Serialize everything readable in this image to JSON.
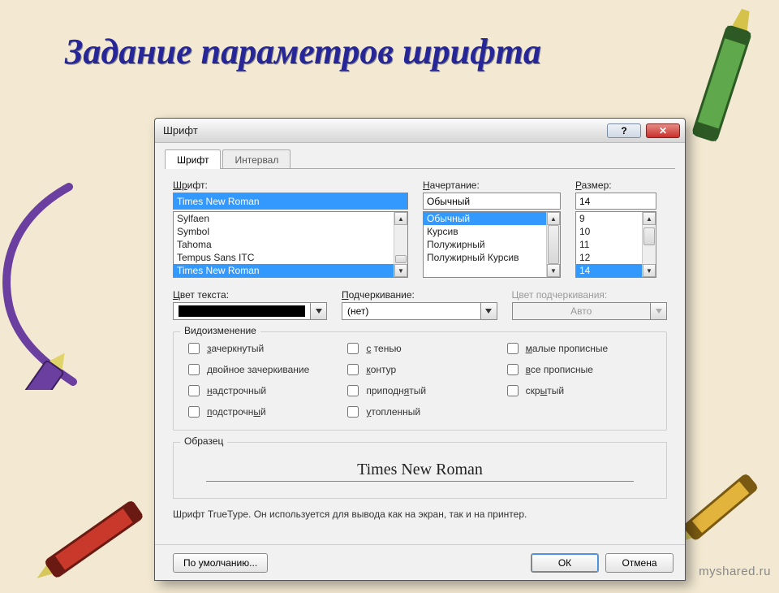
{
  "slide": {
    "title": "Задание параметров шрифта"
  },
  "watermark": "myshared.ru",
  "window": {
    "title": "Шрифт"
  },
  "tabs": {
    "font": "Шрифт",
    "interval": "Интервал"
  },
  "labels": {
    "font": "Шрифт:",
    "style": "Начертание:",
    "size": "Размер:",
    "textColor": "Цвет текста:",
    "underline": "Подчеркивание:",
    "underlineColor": "Цвет подчеркивания:",
    "effects": "Видоизменение",
    "sample": "Образец"
  },
  "font": {
    "value": "Times New Roman",
    "list": [
      "Sylfaen",
      "Symbol",
      "Tahoma",
      "Tempus Sans ITC",
      "Times New Roman"
    ],
    "selected": "Times New Roman"
  },
  "style": {
    "value": "Обычный",
    "list": [
      "Обычный",
      "Курсив",
      "Полужирный",
      "Полужирный Курсив"
    ],
    "selected": "Обычный"
  },
  "size": {
    "value": "14",
    "list": [
      "9",
      "10",
      "11",
      "12",
      "14"
    ],
    "selected": "14"
  },
  "underline": {
    "value": "(нет)"
  },
  "underlineColor": {
    "value": "Авто"
  },
  "effects": {
    "col1": [
      {
        "label": "зачеркнутый",
        "u": "з"
      },
      {
        "label": "двойное зачеркивание"
      },
      {
        "label": "надстрочный",
        "u": "н"
      },
      {
        "label": "подстрочный",
        "u": "п"
      }
    ],
    "col2": [
      {
        "label": "с тенью",
        "u": "с"
      },
      {
        "label": "контур",
        "u": "к"
      },
      {
        "label": "приподнятый",
        "u": "я"
      },
      {
        "label": "утопленный",
        "u": "у"
      }
    ],
    "col3": [
      {
        "label": "малые прописные",
        "u": "м"
      },
      {
        "label": "все прописные",
        "u": "в"
      },
      {
        "label": "скрытый",
        "u": "ы"
      }
    ]
  },
  "sample": {
    "text": "Times New Roman"
  },
  "hint": "Шрифт TrueType. Он используется для вывода как на экран, так и на принтер.",
  "buttons": {
    "default": "По умолчанию...",
    "ok": "ОК",
    "cancel": "Отмена"
  }
}
